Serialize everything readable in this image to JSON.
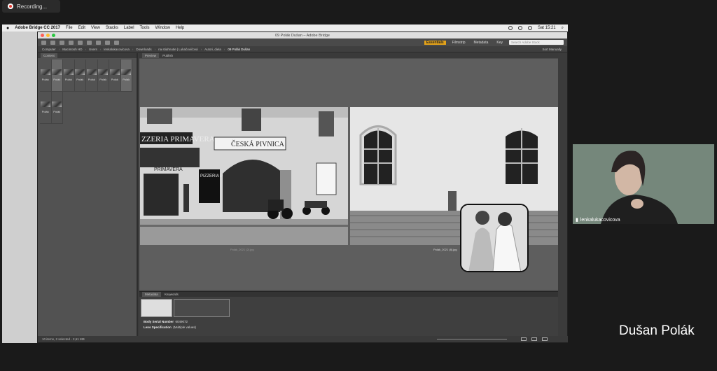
{
  "recording": {
    "label": "Recording..."
  },
  "mac_menubar": {
    "app": "Adobe Bridge CC 2017",
    "menus": [
      "File",
      "Edit",
      "View",
      "Stacks",
      "Label",
      "Tools",
      "Window",
      "Help"
    ],
    "clock": "Sat 15:21"
  },
  "window": {
    "title": "09 Polák Dušan – Adobe Bridge"
  },
  "toolbar": {
    "workspaces": [
      "Essentials",
      "Filmstrip",
      "Metadata",
      "Key"
    ],
    "search_placeholder": "Search Adobe Stock"
  },
  "pathbar": {
    "crumbs": [
      "Computer",
      "Macintosh HD",
      "Users",
      "lenkalukacovicova",
      "Downloads",
      "na stiahnutie | Lukačovičová",
      "Autori, diela",
      "09 Polák Dušan"
    ],
    "sort_label": "Sort Manually"
  },
  "panels": {
    "content_tab": "Content",
    "preview_tab": "Preview",
    "publish_tab": "Publish",
    "metadata_tab": "Metadata",
    "keywords_tab": "Keywords"
  },
  "thumbnails": [
    {
      "label": "Polák"
    },
    {
      "label": "Polák"
    },
    {
      "label": "Polák"
    },
    {
      "label": "Polák"
    },
    {
      "label": "Polák"
    },
    {
      "label": "Polák"
    },
    {
      "label": "Polák"
    },
    {
      "label": "Polák"
    },
    {
      "label": "Polák"
    },
    {
      "label": "Polák"
    }
  ],
  "preview": {
    "photo1_caption": "Polák_2021 (2).jpg",
    "photo2_caption": "Polák_2021 (8).jpg",
    "sign1": "ZZERIA PRIMAVERA",
    "sign2": "ČESKÁ PIVNICA",
    "sign3": "PRIMAVERA",
    "sign4": "PIZZERIA PRIMAVERA"
  },
  "metadata": {
    "body_serial_label": "Body Serial Number",
    "body_serial_value": "6049072",
    "lens_label": "Lens Specification",
    "lens_value": "(Multiple values)"
  },
  "status": {
    "text": "10 items, 2 selected - 2,61 MB"
  },
  "webcam": {
    "name": "lenkalukacovicova"
  },
  "participant": {
    "name": "Dušan Polák"
  }
}
